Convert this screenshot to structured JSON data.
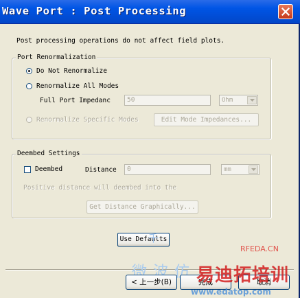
{
  "window": {
    "title": "Wave Port : Post Processing"
  },
  "intro_text": "Post processing operations do not affect field plots.",
  "port_renormalization": {
    "legend": "Port Renormalization",
    "do_not_renormalize": "Do Not Renormalize",
    "renormalize_all": "Renormalize All Modes",
    "full_port_impedance_label": "Full Port Impedanc",
    "full_port_impedance_value": "50",
    "impedance_unit": "Ohm",
    "renormalize_specific": "Renormalize Specific Modes",
    "edit_mode_impedances": "Edit Mode Impedances..."
  },
  "deembed": {
    "legend": "Deembed Settings",
    "deembed_label": "Deembed",
    "distance_label": "Distance",
    "distance_value": "0",
    "distance_unit": "mm",
    "hint": "Positive distance will deembed into the",
    "get_distance": "Get Distance Graphically..."
  },
  "use_defaults": "Use Defaults",
  "wizard": {
    "back": "< 上一步(B)",
    "next": "完成",
    "cancel": "取消"
  },
  "watermark": {
    "rfeda": "RFEDA.CN",
    "microwave": "微 波 仿",
    "brand": "易迪拓培训",
    "url": "www.edatop.com",
    "glyph": "千"
  },
  "colors": {
    "titlebar": "#0055E5",
    "dialog_bg": "#ECE9D8",
    "close_button": "#C5391A",
    "watermark_red": "#D42020",
    "watermark_blue": "#4A8FD8"
  }
}
